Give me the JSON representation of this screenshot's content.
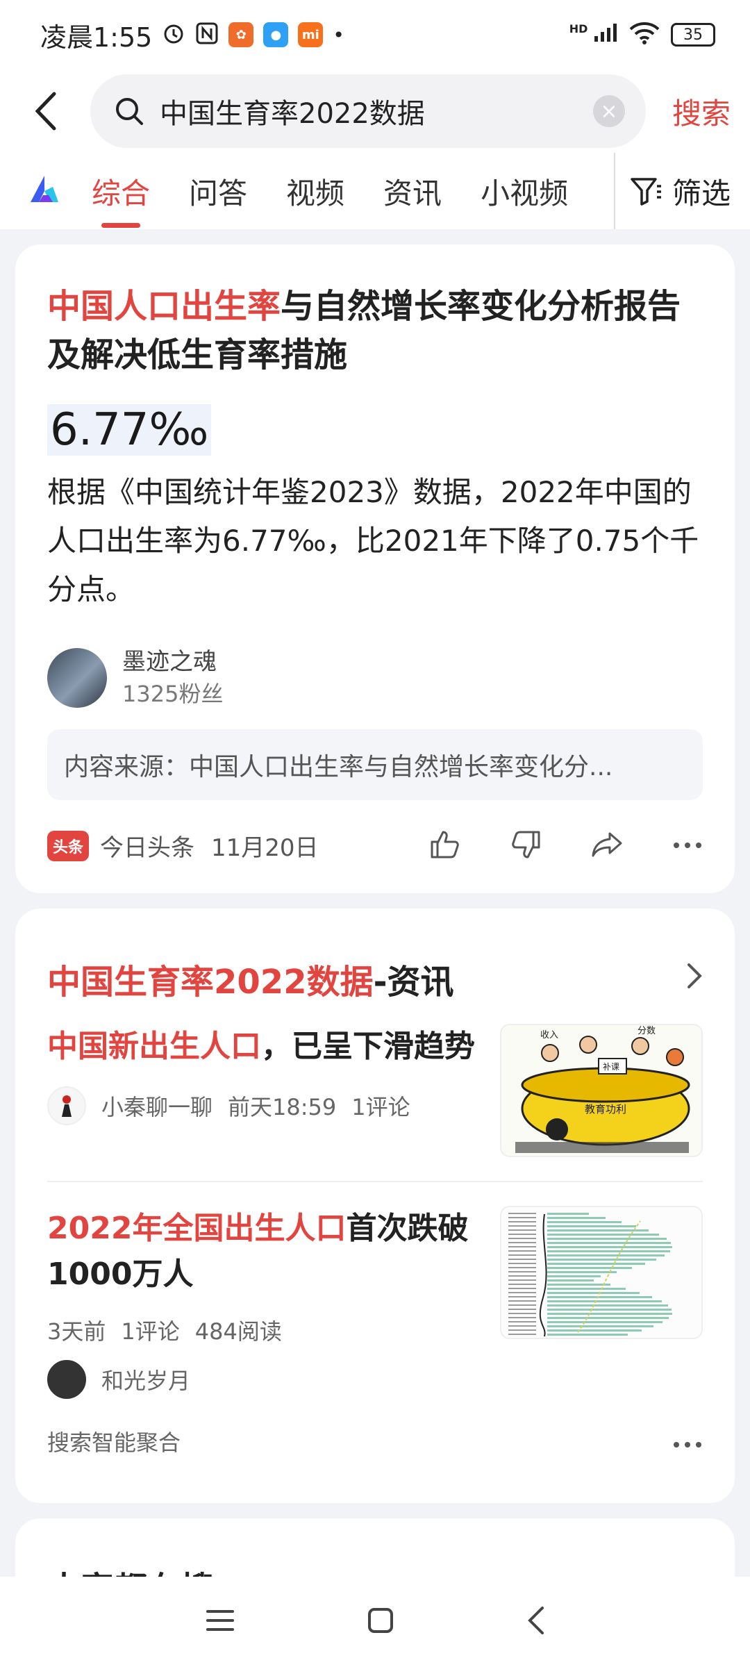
{
  "status": {
    "time": "凌晨1:55",
    "network": "HD",
    "battery": "35"
  },
  "search": {
    "query": "中国生育率2022数据",
    "button": "搜索"
  },
  "tabs": [
    "综合",
    "问答",
    "视频",
    "资讯",
    "小视频"
  ],
  "filter_label": "筛选",
  "card1": {
    "title_highlight": "中国人口出生率",
    "title_rest": "与自然增长率变化分析报告及解决低生育率措施",
    "big_value": "6.77‰",
    "body": "根据《中国统计年鉴2023》数据，2022年中国的人口出生率为6.77‰，比2021年下降了0.75个千分点。",
    "author_name": "墨迹之魂",
    "author_fans": "1325粉丝",
    "source_box": "内容来源：中国人口出生率与自然增长率变化分...",
    "source_badge": "头条",
    "source_name": "今日头条",
    "date": "11月20日"
  },
  "card2": {
    "title_highlight": "中国生育率2022数据",
    "title_rest": "-资讯",
    "news": [
      {
        "title_highlight": "中国新出生人口",
        "title_rest": "，已呈下滑趋势",
        "author": "小秦聊一聊",
        "time": "前天18:59",
        "comments": "1评论",
        "thumb_text": [
          "收入",
          "分数",
          "教育功利",
          "补课"
        ]
      },
      {
        "title_highlight": "2022年全国出生人口",
        "title_rest": "首次跌破1000万人",
        "age": "3天前",
        "comments": "1评论",
        "reads": "484阅读",
        "author": "和光岁月"
      }
    ],
    "cluster_label": "搜索智能聚合"
  },
  "card3": {
    "title": "大家都在搜"
  },
  "colors": {
    "accent": "#e2453f",
    "background": "#f2f3f7"
  }
}
